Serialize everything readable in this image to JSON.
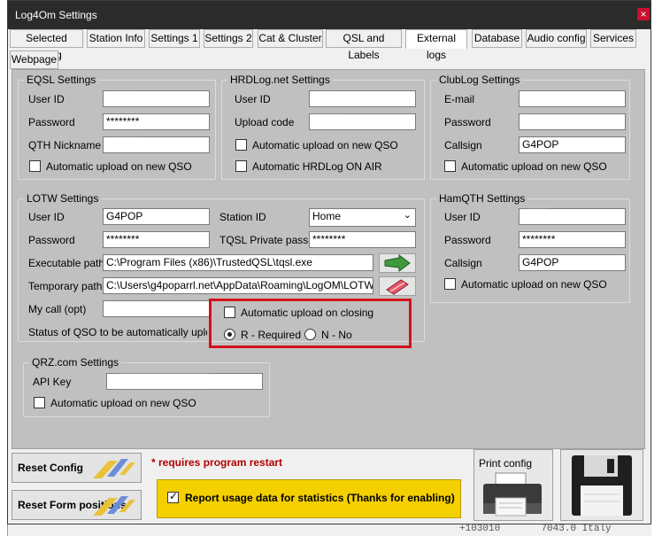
{
  "window": {
    "title": "Log4Om Settings",
    "close": "×"
  },
  "tabs": [
    "Selected Config",
    "Station Info",
    "Settings 1",
    "Settings 2",
    "Cat & Cluster",
    "QSL and Labels",
    "External logs",
    "Database",
    "Audio config",
    "Services",
    "Webpage"
  ],
  "active_tab": "External logs",
  "eqsl": {
    "title": "EQSL Settings",
    "user_label": "User ID",
    "user_value": "",
    "password_label": "Password",
    "password_value": "********",
    "qth_label": "QTH Nickname",
    "qth_value": "",
    "auto_label": "Automatic upload on new QSO"
  },
  "hrdlog": {
    "title": "HRDLog.net Settings",
    "user_label": "User ID",
    "user_value": "",
    "code_label": "Upload code",
    "code_value": "",
    "auto_label": "Automatic upload on new QSO",
    "onair_label": "Automatic HRDLog ON AIR"
  },
  "clublog": {
    "title": "ClubLog Settings",
    "email_label": "E-mail",
    "email_value": "",
    "password_label": "Password",
    "password_value": "",
    "call_label": "Callsign",
    "call_value": "G4POP",
    "auto_label": "Automatic upload on new QSO"
  },
  "lotw": {
    "title": "LOTW Settings",
    "user_label": "User ID",
    "user_value": "G4POP",
    "password_label": "Password",
    "password_value": "********",
    "station_label": "Station ID",
    "station_value": "Home",
    "tqsl_label": "TQSL Private pass",
    "tqsl_value": "********",
    "exe_label": "Executable path",
    "exe_value": "C:\\Program Files (x86)\\TrustedQSL\\tqsl.exe",
    "temp_label": "Temporary path",
    "temp_value": "C:\\Users\\g4poparrl.net\\AppData\\Roaming\\LogOM\\LOTW",
    "mycall_label": "My call (opt)",
    "mycall_value": "",
    "status_label": "Status of QSO to be automatically uploaded",
    "auto_close_label": "Automatic upload on closing",
    "radio_r": "R - Required",
    "radio_n": "N - No"
  },
  "hamqth": {
    "title": "HamQTH Settings",
    "user_label": "User ID",
    "user_value": "",
    "password_label": "Password",
    "password_value": "********",
    "call_label": "Callsign",
    "call_value": "G4POP",
    "auto_label": "Automatic upload on new QSO"
  },
  "qrz": {
    "title": "QRZ.com Settings",
    "api_label": "API Key",
    "api_value": "",
    "auto_label": "Automatic upload on new QSO"
  },
  "bottom": {
    "reset_config": "Reset Config",
    "reset_form": "Reset Form positions",
    "restart_note": "* requires program restart",
    "usage_label": "Report usage data for statistics (Thanks for enabling)",
    "print_label": "Print config"
  },
  "background": {
    "log_text": "7043.0 Italy",
    "log_fragment": "+103010"
  },
  "colors": {
    "title_bar": "#2b2b2b",
    "panel": "#c0c0c0",
    "highlight_box": "#d3101a",
    "usage_bg": "#f5d000",
    "restart_note": "#b00000"
  }
}
